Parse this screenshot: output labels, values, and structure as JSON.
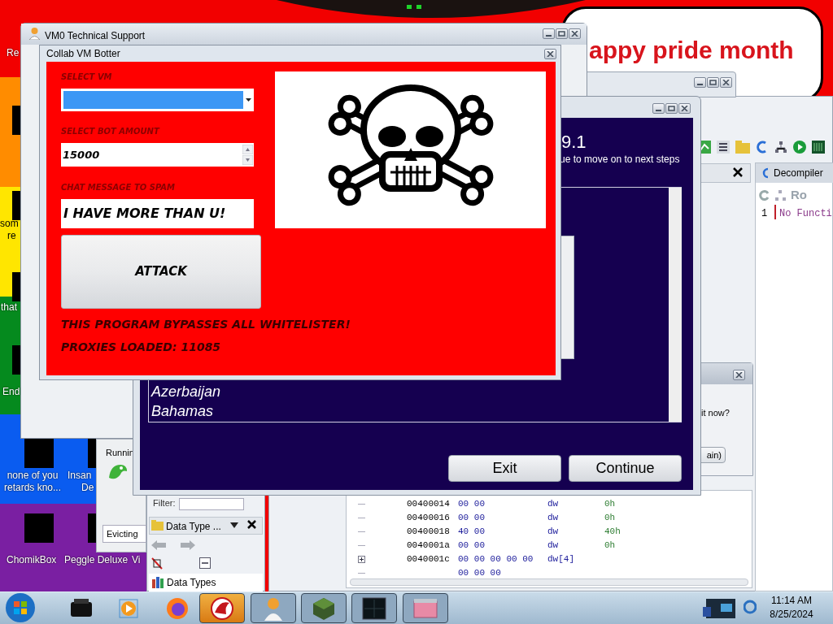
{
  "desktop": {
    "banner": "appy pride month",
    "icons": [
      {
        "label": "Re"
      },
      {
        "label": "som"
      },
      {
        "label": "re"
      },
      {
        "label": "that"
      },
      {
        "label": "End"
      },
      {
        "label": "none of you retards kno..."
      },
      {
        "label": "Insan"
      },
      {
        "label": "De"
      },
      {
        "label": "ChomikBox"
      },
      {
        "label": "Peggle Deluxe"
      },
      {
        "label": "Vi"
      }
    ]
  },
  "disassembler": {
    "decompiler_tab": "Decompiler",
    "toolbar_text": "Ro",
    "line_number": "1",
    "code": "No Functi",
    "listing": [
      {
        "address": "00400014",
        "bytes": "00 00",
        "mnemonic": "dw",
        "operand": "0h",
        "expandable": false
      },
      {
        "address": "00400016",
        "bytes": "00 00",
        "mnemonic": "dw",
        "operand": "0h",
        "expandable": false
      },
      {
        "address": "00400018",
        "bytes": "40 00",
        "mnemonic": "dw",
        "operand": "40h",
        "expandable": false
      },
      {
        "address": "0040001a",
        "bytes": "00 00",
        "mnemonic": "dw",
        "operand": "0h",
        "expandable": false
      },
      {
        "address": "0040001c",
        "bytes": "00 00 00 00 00",
        "mnemonic": "dw[4]",
        "expandable": true
      },
      {
        "bytes": "00 00 00",
        "expandable": false
      }
    ]
  },
  "data_type_panel": {
    "filter_label": "Filter:",
    "title": "Data Type ...",
    "tree_root": "Data Types"
  },
  "running_window": {
    "group_label": "Runnin",
    "status": "Evicting"
  },
  "dialog": {
    "text": "it now?",
    "button": "ain)"
  },
  "vm0_window": {
    "title": "VM0 Technical Support"
  },
  "installer": {
    "heading": "9.1",
    "subtitle": "ue to move on to next steps",
    "list_items": [
      "Azerbaijan",
      "Bahamas"
    ],
    "buttons": [
      "Exit",
      "Continue"
    ]
  },
  "botter": {
    "title": "Collab VM Botter",
    "vm_label": "SELECT VM",
    "bot_label": "SELECT BOT AMOUNT",
    "bot_amount": "15000",
    "chat_label": "CHAT MESSAGE TO SPAM",
    "chat_message": "I HAVE MORE THAN U!",
    "attack_button": "ATTACK",
    "notes": [
      "THIS PROGRAM BYPASSES ALL WHITELISTER!",
      "PROXIES LOADED: 11085"
    ]
  },
  "taskbar": {
    "items": [
      {
        "selected": false,
        "running": false
      },
      {
        "selected": false,
        "running": false
      },
      {
        "selected": false,
        "running": false
      },
      {
        "selected": true,
        "running": true
      },
      {
        "selected": false,
        "running": true
      },
      {
        "selected": false,
        "running": true
      },
      {
        "selected": false,
        "running": true
      },
      {
        "selected": false,
        "running": true
      }
    ],
    "time": "11:14 AM",
    "date": "8/25/2024"
  }
}
